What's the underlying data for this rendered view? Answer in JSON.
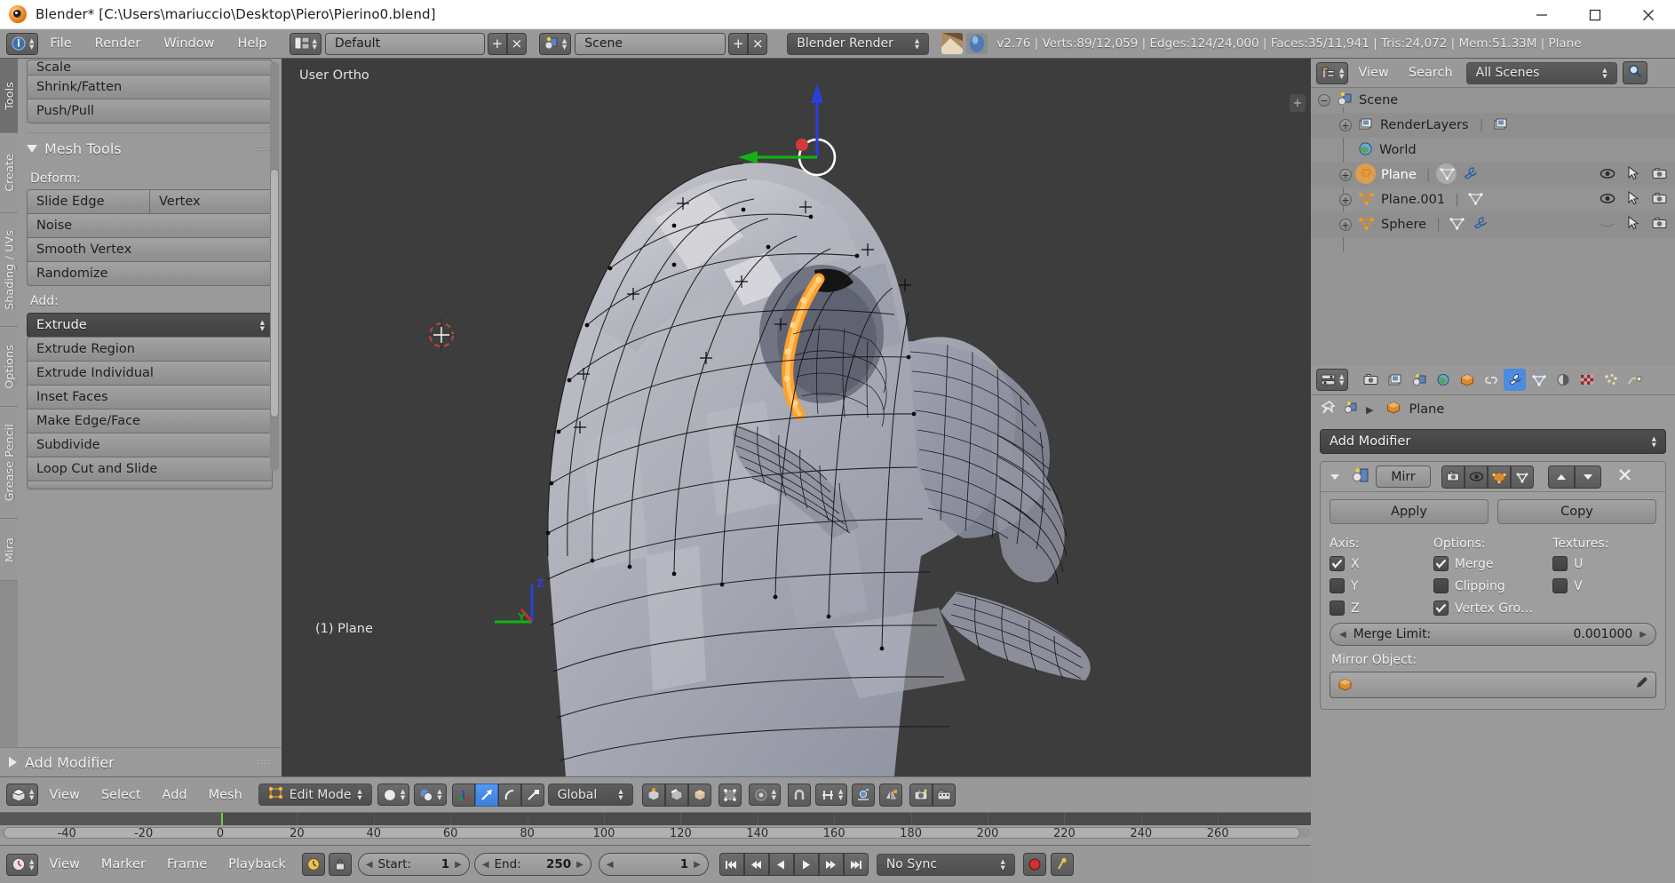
{
  "window": {
    "title": "Blender* [C:\\Users\\mariuccio\\Desktop\\Piero\\Pierino0.blend]",
    "minimize": "minimize-icon",
    "maximize": "maximize-icon",
    "close": "close-icon"
  },
  "info_header": {
    "menus": [
      "File",
      "Render",
      "Window",
      "Help"
    ],
    "screen_layout": "Default",
    "scene": "Scene",
    "engine": "Blender Render",
    "add_label": "+",
    "remove_label": "×",
    "stats": "v2.76 | Verts:89/12,059 | Edges:124/24,000 | Faces:35/11,941 | Tris:24,072 | Mem:51.33M | Plane"
  },
  "toolshelf": {
    "tabs": [
      "Tools",
      "Create",
      "Shading / UVs",
      "Options",
      "Grease Pencil",
      "Mira"
    ],
    "active_tab": "Tools",
    "transform_buttons": [
      "Scale",
      "Shrink/Fatten",
      "Push/Pull"
    ],
    "mesh_tools_title": "Mesh Tools",
    "deform_label": "Deform:",
    "deform_buttons": [
      "Slide Edge",
      "Vertex",
      "Noise",
      "Smooth Vertex",
      "Randomize"
    ],
    "add_label": "Add:",
    "add_dropdown": "Extrude",
    "add_buttons": [
      "Extrude Region",
      "Extrude Individual",
      "Inset Faces",
      "Make Edge/Face",
      "Subdivide",
      "Loop Cut and Slide"
    ],
    "add_modifier_label": "Add Modifier"
  },
  "viewport": {
    "view_name": "User Ortho",
    "object_label": "(1) Plane",
    "axis_z": "Z",
    "axis_y": "Y",
    "plus_tab": "+"
  },
  "viewport_header": {
    "menus": [
      "View",
      "Select",
      "Add",
      "Mesh"
    ],
    "mode": "Edit Mode",
    "transform_orientation": "Global",
    "editor_type_icon": "editor-type-icon",
    "shading_icon": "viewport-shading-icon",
    "pivot_icon": "pivot-point-icon",
    "manipulator_icons": [
      "translate-manipulator-icon",
      "rotate-manipulator-icon",
      "scale-manipulator-icon"
    ],
    "select_mode_icons": [
      "vertex-select-icon",
      "edge-select-icon",
      "face-select-icon"
    ],
    "proportional_icon": "proportional-edit-icon",
    "snap_icon": "snap-magnet-icon",
    "snap_target_icon": "snap-target-icon",
    "mirror_icon": "x-mirror-icon",
    "occlude_icon": "occlude-geometry-icon",
    "render_icon": "render-image-icon",
    "animation_icon": "render-animation-icon"
  },
  "timeline": {
    "ruler_ticks": [
      -40,
      -20,
      0,
      20,
      40,
      60,
      80,
      100,
      120,
      140,
      160,
      180,
      200,
      220,
      240,
      260
    ],
    "playhead_frame": 0,
    "menus": [
      "View",
      "Marker",
      "Frame",
      "Playback"
    ],
    "start_label": "Start:",
    "start_value": "1",
    "end_label": "End:",
    "end_value": "250",
    "current_frame": "1",
    "sync_mode": "No Sync",
    "transport_icons": [
      "jump-to-start-icon",
      "previous-keyframe-icon",
      "play-reverse-icon",
      "play-icon",
      "next-keyframe-icon",
      "jump-to-end-icon"
    ],
    "record_icon": "record-icon",
    "auto_key_icon": "auto-keying-icon",
    "lock_icon": "lock-icon",
    "clock_icon": "clock-icon"
  },
  "outliner": {
    "menus": [
      "View",
      "Search"
    ],
    "display_mode": "All Scenes",
    "search_icon": "search-icon",
    "editor_icon": "outliner-editor-icon",
    "rows": [
      {
        "label": "Scene",
        "icon": "scene-icon",
        "indent": 0,
        "expander": "minus",
        "selected": false
      },
      {
        "label": "RenderLayers",
        "icon": "render-layers-icon",
        "indent": 1,
        "expander": "plus",
        "selected": false
      },
      {
        "label": "World",
        "icon": "world-icon",
        "indent": 1,
        "expander": "none",
        "selected": false
      },
      {
        "label": "Plane",
        "icon": "mesh-object-icon",
        "indent": 1,
        "expander": "plus",
        "selected": true
      },
      {
        "label": "Plane.001",
        "icon": "mesh-object-icon",
        "indent": 1,
        "expander": "plus",
        "selected": false
      },
      {
        "label": "Sphere",
        "icon": "mesh-object-icon",
        "indent": 1,
        "expander": "plus",
        "selected": false
      }
    ]
  },
  "properties": {
    "tab_icons": [
      "render-tab-icon",
      "render-layers-tab-icon",
      "scene-tab-icon",
      "world-tab-icon",
      "object-tab-icon",
      "constraints-tab-icon",
      "modifiers-tab-icon",
      "data-tab-icon",
      "material-tab-icon",
      "texture-tab-icon",
      "particles-tab-icon",
      "physics-tab-icon"
    ],
    "active_tab": "modifiers-tab-icon",
    "breadcrumb_object": "Plane",
    "pin_icon": "pin-icon",
    "add_modifier": "Add Modifier",
    "modifier": {
      "name": "Mirr",
      "icon": "mirror-modifier-icon",
      "collapse_icon": "collapse-triangle-icon",
      "toggle_icons": [
        "render-toggle-icon",
        "realtime-toggle-icon",
        "edit-mode-toggle-icon",
        "cage-toggle-icon"
      ],
      "move_up_icon": "move-up-icon",
      "move_down_icon": "move-down-icon",
      "delete_icon": "delete-x-icon",
      "apply_label": "Apply",
      "copy_label": "Copy",
      "axis_label": "Axis:",
      "options_label": "Options:",
      "textures_label": "Textures:",
      "axis": [
        {
          "label": "X",
          "checked": true
        },
        {
          "label": "Y",
          "checked": false
        },
        {
          "label": "Z",
          "checked": false
        }
      ],
      "options": [
        {
          "label": "Merge",
          "checked": true
        },
        {
          "label": "Clipping",
          "checked": false
        },
        {
          "label": "Vertex Gro…",
          "checked": true
        }
      ],
      "textures": [
        {
          "label": "U",
          "checked": false
        },
        {
          "label": "V",
          "checked": false
        }
      ],
      "merge_limit_label": "Merge Limit:",
      "merge_limit_value": "0.001000",
      "mirror_object_label": "Mirror Object:",
      "mirror_object_value": "",
      "eyedropper_icon": "eyedropper-icon"
    }
  },
  "colors": {
    "header_grey": "#999999",
    "panel_grey": "#9a9a9a",
    "viewport_bg": "#3d3d3d",
    "accent_blue": "#4d8ae0",
    "selected_orange": "#ffa028",
    "playhead_green": "#6fd13a"
  }
}
